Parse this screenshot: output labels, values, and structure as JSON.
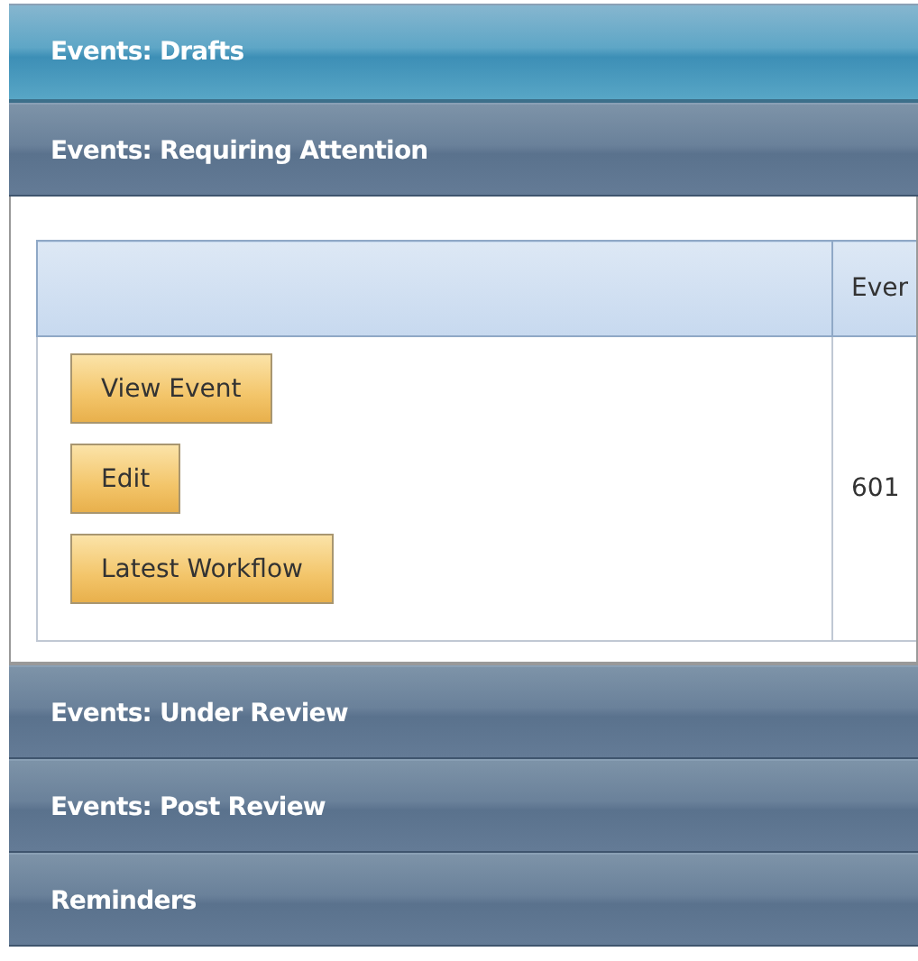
{
  "panels": [
    {
      "title": "Events: Drafts",
      "kind": "highlighted"
    },
    {
      "title": "Events: Requiring Attention",
      "kind": "normal",
      "table": {
        "columns": [
          "",
          "Ever"
        ],
        "rows": [
          {
            "actions": [
              "View Event",
              "Edit",
              "Latest Workflow"
            ],
            "column_2": "601"
          }
        ]
      }
    },
    {
      "title": "Events: Under Review",
      "kind": "normal"
    },
    {
      "title": "Events: Post Review",
      "kind": "normal"
    },
    {
      "title": "Reminders",
      "kind": "normal"
    }
  ]
}
